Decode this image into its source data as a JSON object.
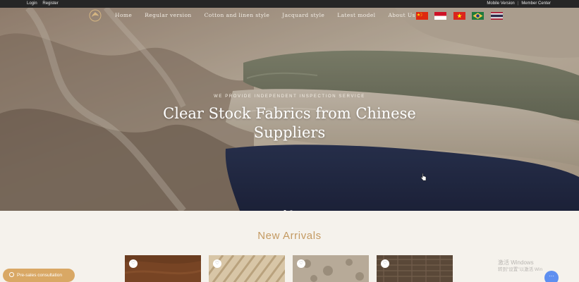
{
  "topbar": {
    "login": "Login",
    "register": "Register",
    "mobile_version": "Mobile Version",
    "member_center": "Member Center",
    "separator": "|"
  },
  "nav": {
    "items": [
      "Home",
      "Regular version",
      "Cotton and linen style",
      "Jacquard style",
      "Latest model",
      "About Us"
    ],
    "flags": [
      "china-flag-icon",
      "indonesia-flag-icon",
      "vietnam-flag-icon",
      "brazil-flag-icon",
      "thailand-flag-icon"
    ]
  },
  "hero": {
    "eyebrow": "WE PROVIDE INDEPENDENT INSPECTION SERVICE",
    "headline_line1": "Clear Stock Fabrics from Chinese",
    "headline_line2": "Suppliers",
    "slides": 2,
    "active_slide": 1
  },
  "section": {
    "title": "New Arrivals"
  },
  "products": [
    {
      "fabric": "brown-suede",
      "color": "#6b3d20",
      "favorite_icon": "heart-icon"
    },
    {
      "fabric": "cream-stripe",
      "color": "#d8c6a7",
      "favorite_icon": "heart-icon"
    },
    {
      "fabric": "beige-jacquard",
      "color": "#b7aa98",
      "favorite_icon": "heart-icon"
    },
    {
      "fabric": "brown-tweed",
      "color": "#5a4838",
      "favorite_icon": "heart-icon"
    }
  ],
  "consult": {
    "label": "Pre-sales consultation",
    "icon": "headset-icon"
  },
  "watermark": {
    "line1": "激活 Windows",
    "line2": "转到\"设置\"以激活 Win"
  },
  "chat": {
    "label": "···",
    "icon": "chat-icon"
  },
  "colors": {
    "accent": "#c49a62",
    "consult": "#d9a865",
    "topbar": "#262626",
    "page_bg": "#f5f2ec"
  }
}
